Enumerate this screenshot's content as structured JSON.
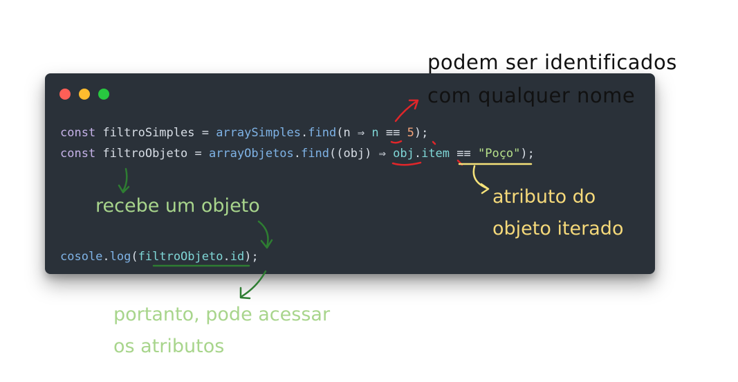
{
  "window": {
    "controls": [
      "close",
      "minimize",
      "maximize"
    ],
    "colors": {
      "background": "#2a3139",
      "close": "#ff5f57",
      "minimize": "#febc2e",
      "maximize": "#28c840"
    }
  },
  "code": {
    "line1": {
      "kw": "const",
      "name": " filtroSimples = ",
      "obj": "arraySimples",
      "dot": ".",
      "fn": "find",
      "args_open": "(n ⇒ ",
      "param_use": "n",
      "cmp": " ≡≡ ",
      "num": "5",
      "close": ");"
    },
    "line2": {
      "kw": "const",
      "name": " filtroObjeto = ",
      "obj": "arrayObjetos",
      "dot": ".",
      "fn": "find",
      "args_open": "((obj) ⇒ ",
      "param_use": "obj",
      "dot2": ".",
      "prop": "item",
      "cmp": " ≡≡ ",
      "str": "\"Poço\"",
      "close": ");"
    },
    "line3": {
      "obj": "cosole",
      "dot": ".",
      "fn": "log",
      "open": "(",
      "arg": "filtroObjeto",
      "dot2": ".",
      "prop": "id",
      "close": ");"
    }
  },
  "annotations": {
    "top_right_line1": "podem ser identificados",
    "top_right_line2": "com qualquer nome",
    "yellow_line1": "atributo do",
    "yellow_line2": "objeto iterado",
    "green_mid": "recebe um objeto",
    "green_bottom_line1": "portanto, pode acessar",
    "green_bottom_line2": "os atributos"
  },
  "colors": {
    "annotation_red": "#e0262a",
    "annotation_yellow": "#f5d97a",
    "annotation_green": "#2e7d32",
    "annotation_green_text": "#a8d58c"
  }
}
